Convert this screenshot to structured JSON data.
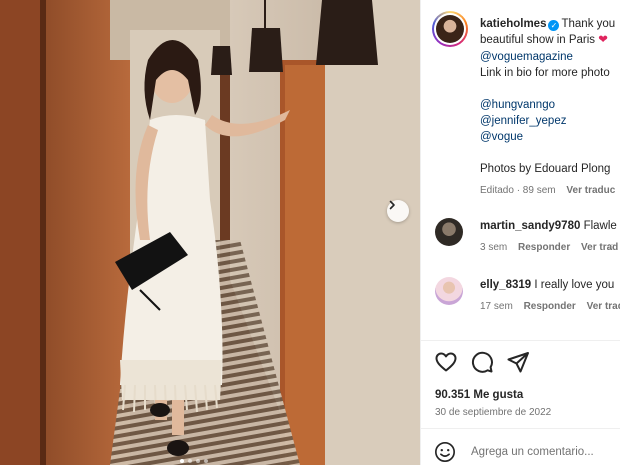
{
  "post": {
    "username": "katieholmes",
    "caption_line1": "Thank you",
    "caption_line2": "beautiful show in Paris",
    "mention_vogue_magazine": "@voguemagazine",
    "caption_line3": "Link in bio for more photo",
    "mentions": [
      "@hungvanngo",
      "@jennifer_yepez",
      "@vogue"
    ],
    "photo_credit": "Photos by Edouard Plong",
    "edited_label": "Editado · 89 sem",
    "translate_label": "Ver traduc"
  },
  "comments": [
    {
      "username": "martin_sandy9780",
      "text": "Flawle",
      "time": "3 sem",
      "reply": "Responder",
      "translate": "Ver trad"
    },
    {
      "username": "elly_8319",
      "text": "I really love you",
      "time": "17 sem",
      "reply": "Responder",
      "translate": "Ver trad"
    }
  ],
  "stats": {
    "likes": "90.351 Me gusta",
    "date": "30 de septiembre de 2022"
  },
  "composer": {
    "placeholder": "Agrega un comentario..."
  },
  "icons": {
    "like": "heart-icon",
    "comment": "comment-icon",
    "share": "send-icon",
    "emoji": "emoji-icon",
    "verified": "verified-badge-icon",
    "next": "chevron-right-icon"
  },
  "colors": {
    "link": "#00376b",
    "verified": "#0095f6",
    "heart_emoji": "#e0245e",
    "muted": "#737373"
  },
  "carousel": {
    "slides": 4,
    "current": 1
  }
}
